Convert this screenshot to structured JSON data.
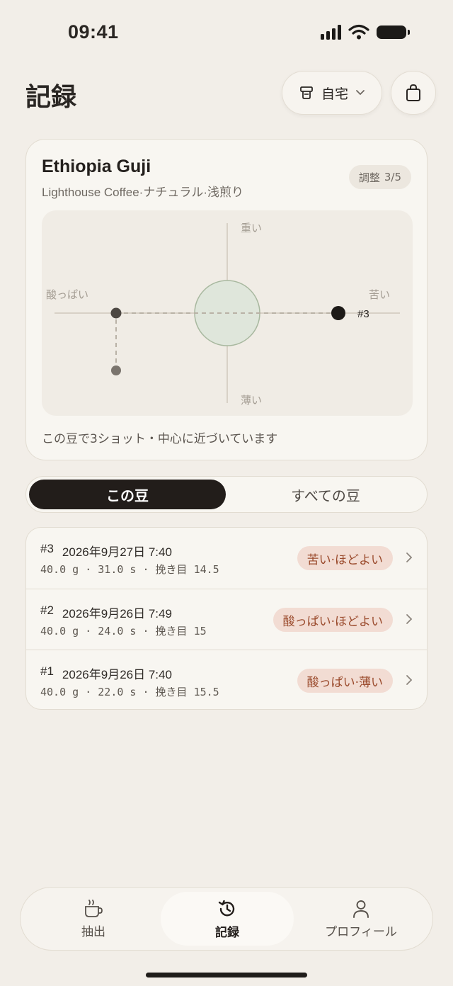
{
  "status": {
    "time": "09:41"
  },
  "header": {
    "title": "記録",
    "location_label": "自宅"
  },
  "bean": {
    "name": "Ethiopia Guji",
    "meta": "Lighthouse Coffee·ナチュラル·浅煎り",
    "adjust_label": "調整",
    "adjust_value": "3/5",
    "plot": {
      "label_top": "重い",
      "label_bottom": "薄い",
      "label_left": "酸っぱい",
      "label_right": "苦い",
      "latest_label": "#3"
    },
    "footer": "この豆で3ショット・中心に近づいています"
  },
  "segment": {
    "active": "この豆",
    "inactive": "すべての豆"
  },
  "shots": [
    {
      "num": "#3",
      "date": "2026年9月27日 7:40",
      "detail": "40.0 g · 31.0 s · 挽き目 14.5",
      "tag": "苦い·ほどよい"
    },
    {
      "num": "#2",
      "date": "2026年9月26日 7:49",
      "detail": "40.0 g · 24.0 s · 挽き目 15",
      "tag": "酸っぱい·ほどよい"
    },
    {
      "num": "#1",
      "date": "2026年9月26日 7:40",
      "detail": "40.0 g · 22.0 s · 挽き目 15.5",
      "tag": "酸っぱい·薄い"
    }
  ],
  "tabs": [
    {
      "label": "抽出",
      "icon": "cup-icon"
    },
    {
      "label": "記録",
      "icon": "history-icon"
    },
    {
      "label": "プロフィール",
      "icon": "person-icon"
    }
  ],
  "colors": {
    "background": "#f2eee8",
    "card": "#f8f6f1",
    "accent_dark": "#221d1a",
    "tag_bg": "#f2dcd3",
    "tag_text": "#9a4a2c",
    "target_fill": "#dfe6db"
  }
}
